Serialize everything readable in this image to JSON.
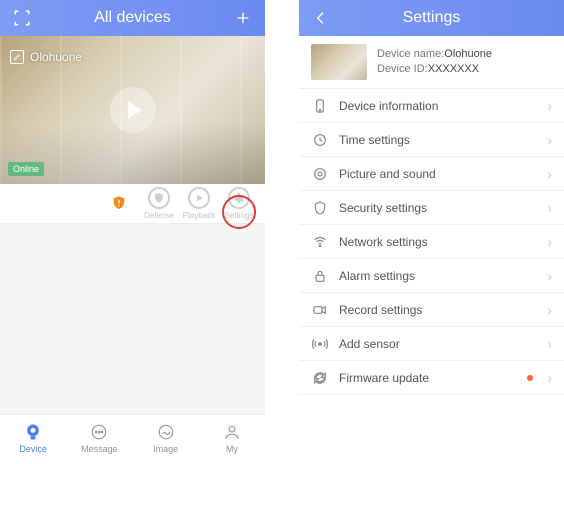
{
  "left": {
    "title": "All devices",
    "camera_name": "Olohuone",
    "online_label": "Online",
    "actions": {
      "defense": "Defense",
      "playback": "Playback",
      "settings": "Settings"
    },
    "tabs": {
      "device": "Device",
      "message": "Message",
      "image": "Image",
      "my": "My"
    }
  },
  "right": {
    "title": "Settings",
    "device_name_label": "Device name:",
    "device_name_value": "Olohuone",
    "device_id_label": "Device ID:",
    "device_id_value": "XXXXXXX",
    "rows": {
      "device_info": "Device information",
      "time": "Time settings",
      "picture": "Picture and sound",
      "security": "Security settings",
      "network": "Network settings",
      "alarm": "Alarm settings",
      "record": "Record settings",
      "sensor": "Add sensor",
      "firmware": "Firmware update"
    }
  }
}
